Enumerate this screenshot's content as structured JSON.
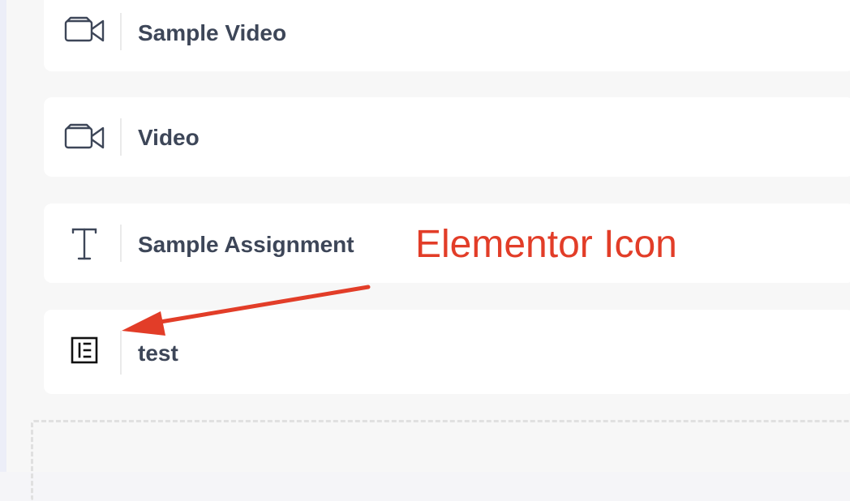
{
  "lessons": [
    {
      "title": "Sample Video",
      "icon": "video-camera-icon"
    },
    {
      "title": "Video",
      "icon": "video-camera-icon"
    },
    {
      "title": "Sample Assignment",
      "icon": "text-type-icon"
    },
    {
      "title": "test",
      "icon": "elementor-icon"
    }
  ],
  "annotation": {
    "text": "Elementor Icon",
    "color": "#e23d28"
  }
}
